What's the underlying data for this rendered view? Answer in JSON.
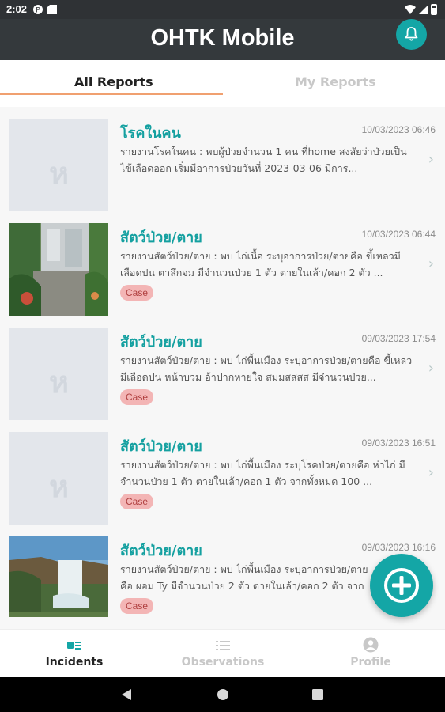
{
  "status_bar": {
    "time": "2:02"
  },
  "app": {
    "title": "OHTK Mobile"
  },
  "tabs": [
    {
      "label": "All Reports",
      "active": true
    },
    {
      "label": "My Reports",
      "active": false
    }
  ],
  "reports": [
    {
      "title": "โรคในคน",
      "date": "10/03/2023 06:46",
      "description": "รายงานโรคในคน : พบผู้ป่วยจำนวน 1 คน ที่home สงสัยว่าป่วยเป็นไข้เลือดออก เริ่มมีอาการป่วยวันที่ 2023-03-06 มีการ...",
      "badge": "",
      "thumbnail": "placeholder",
      "placeholder_glyph": "ห"
    },
    {
      "title": "สัตว์ป่วย/ตาย",
      "date": "10/03/2023 06:44",
      "description": "รายงานสัตว์ป่วย/ตาย : พบ ไก่เนื้อ ระบุอาการป่วย/ตายคือ ขี้เหลวมีเลือดปน ตาลึกจม มีจำนวนป่วย 1 ตัว ตายในเล้า/คอก 2 ตัว ...",
      "badge": "Case",
      "thumbnail": "garden-photo",
      "placeholder_glyph": ""
    },
    {
      "title": "สัตว์ป่วย/ตาย",
      "date": "09/03/2023 17:54",
      "description": "รายงานสัตว์ป่วย/ตาย : พบ ไก่พื้นเมือง ระบุอาการป่วย/ตายคือ ขี้เหลวมีเลือดปน หน้าบวม อ้าปากหายใจ สมมสสสส มีจำนวนป่วย...",
      "badge": "Case",
      "thumbnail": "placeholder",
      "placeholder_glyph": "ห"
    },
    {
      "title": "สัตว์ป่วย/ตาย",
      "date": "09/03/2023 16:51",
      "description": "รายงานสัตว์ป่วย/ตาย : พบ ไก่พื้นเมือง ระบุโรคป่วย/ตายคือ ห่าไก่ มีจำนวนป่วย 1 ตัว ตายในเล้า/คอก 1 ตัว จากทั้งหมด 100 ...",
      "badge": "Case",
      "thumbnail": "placeholder",
      "placeholder_glyph": "ห"
    },
    {
      "title": "สัตว์ป่วย/ตาย",
      "date": "09/03/2023 16:16",
      "description": "รายงานสัตว์ป่วย/ตาย : พบ ไก่พื้นเมือง ระบุอาการป่วย/ตายคือ ผอม Ty มีจำนวนป่วย 2 ตัว ตายในเล้า/คอก 2 ตัว จากทั้งหมด...",
      "badge": "Case",
      "thumbnail": "waterfall-photo",
      "placeholder_glyph": ""
    }
  ],
  "bottom_nav": [
    {
      "label": "Incidents",
      "icon": "incidents-icon",
      "active": true
    },
    {
      "label": "Observations",
      "icon": "list-icon",
      "active": false
    },
    {
      "label": "Profile",
      "icon": "profile-icon",
      "active": false
    }
  ],
  "colors": {
    "teal": "#14a6a6",
    "header_bg": "#34393c",
    "badge_bg": "#f3b5b5",
    "tab_indicator": "#f0a070"
  }
}
